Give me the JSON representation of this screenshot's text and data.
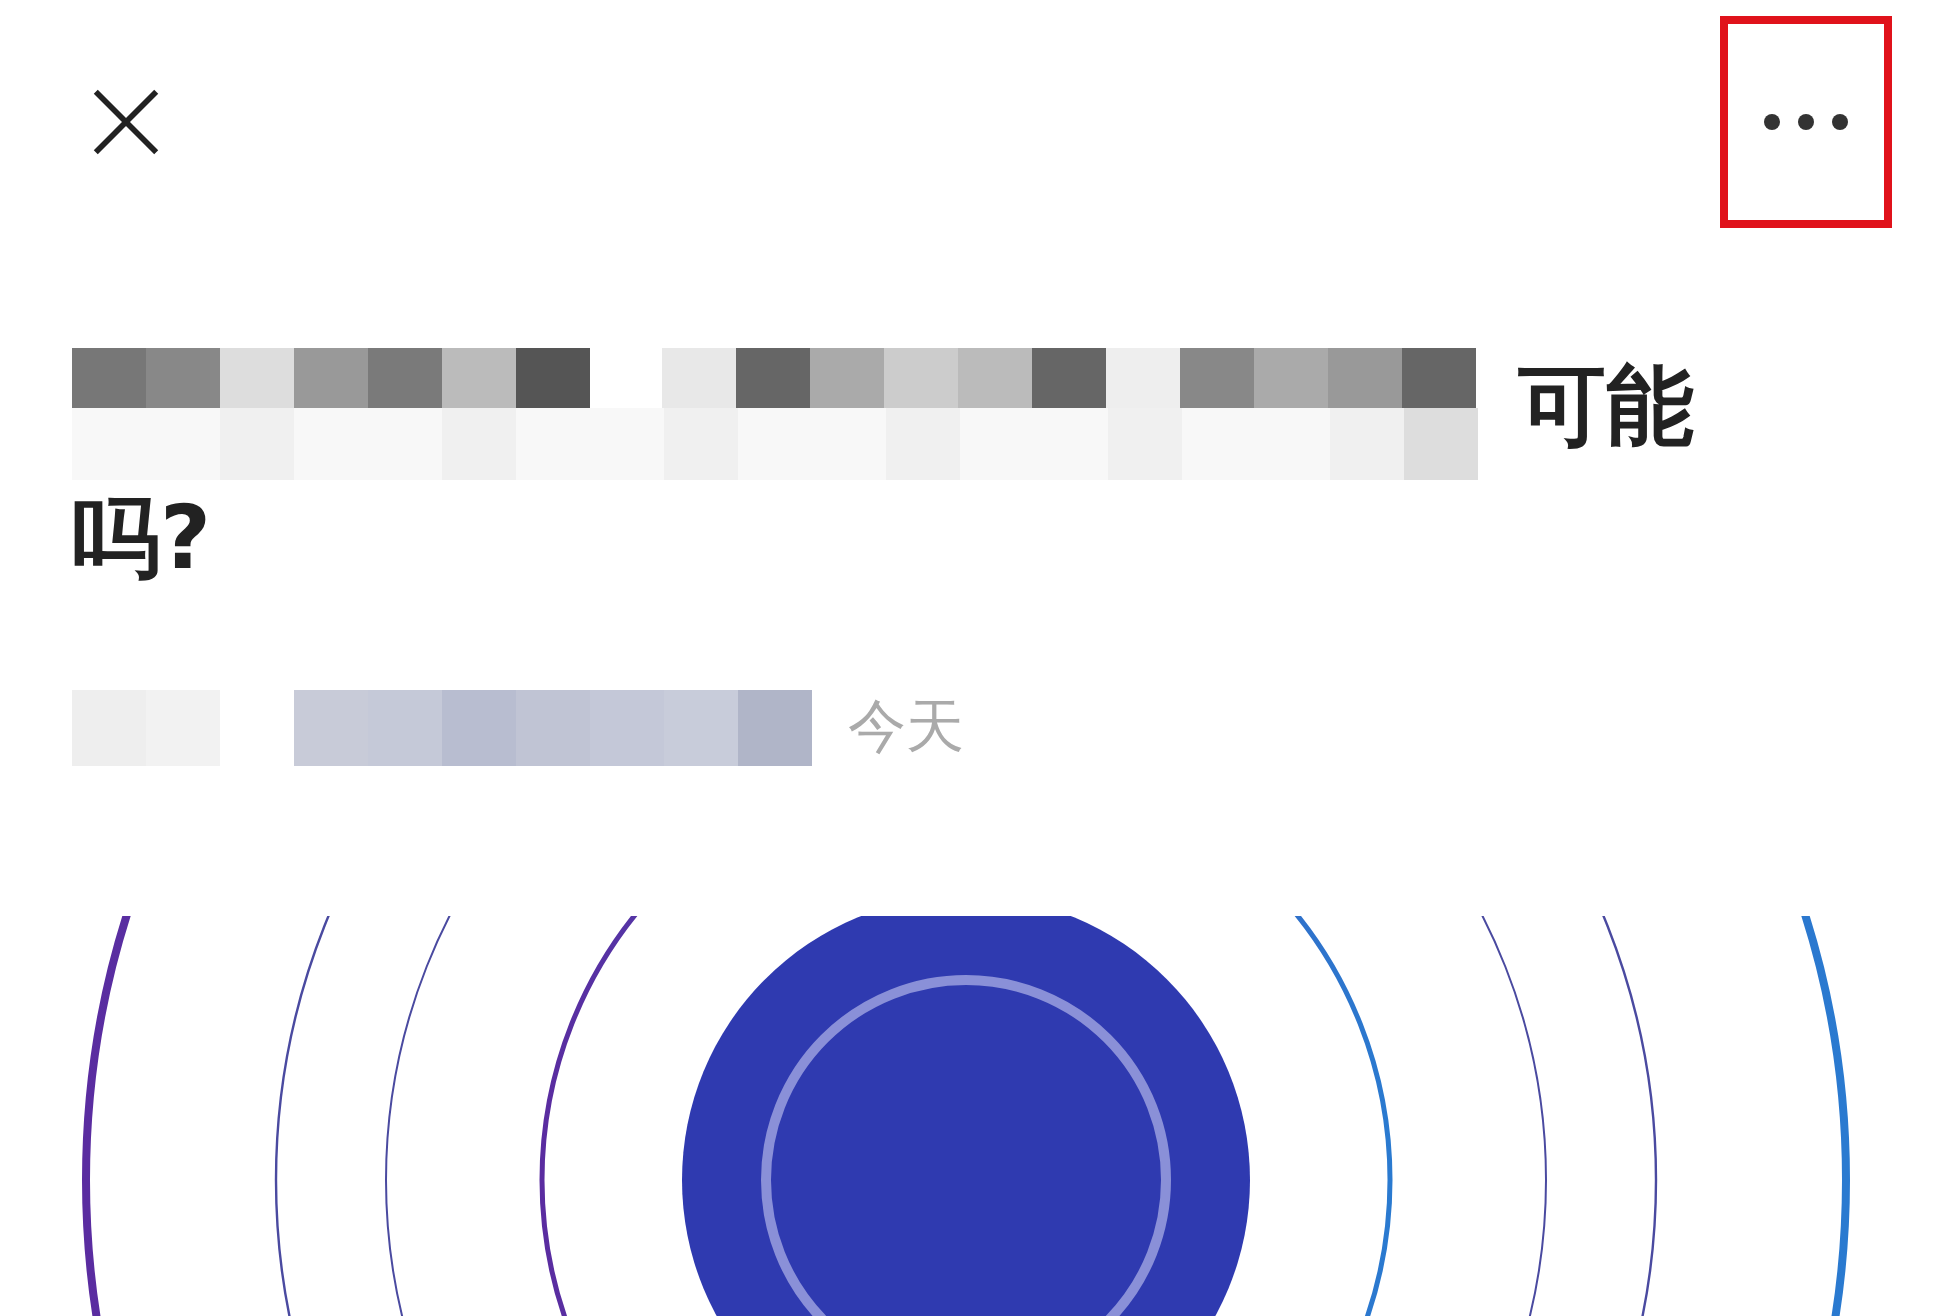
{
  "top_bar": {
    "more_button": {
      "highlighted": true
    }
  },
  "article": {
    "title_line1_end": "可能",
    "title_line2": "吗?",
    "date": "今天"
  }
}
